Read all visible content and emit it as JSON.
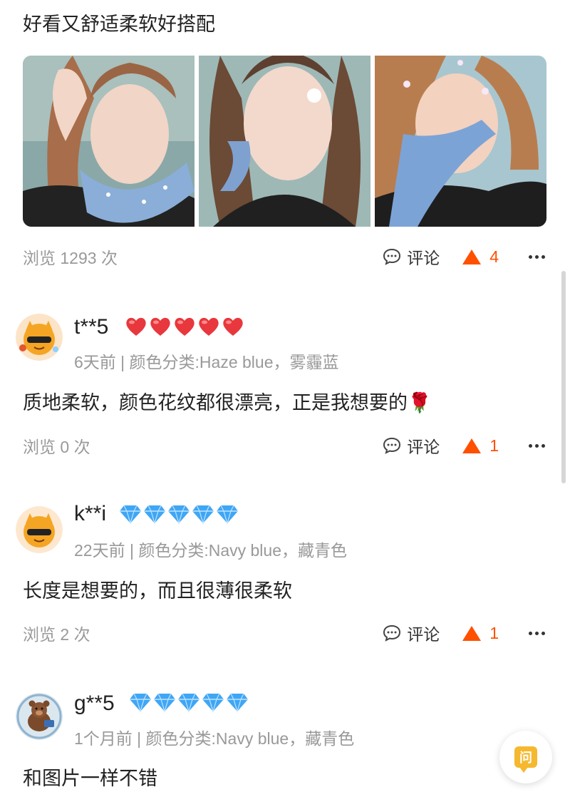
{
  "post": {
    "text": "好看又舒适柔软好搭配",
    "views": "浏览 1293 次",
    "comment_label": "评论",
    "likes": "4"
  },
  "reviews": [
    {
      "username": "t**5",
      "badge_type": "heart",
      "badge_count": 5,
      "meta": "6天前 | 颜色分类:Haze blue，雾霾蓝",
      "content": "质地柔软，颜色花纹都很漂亮，正是我想要的🌹",
      "views": "浏览 0 次",
      "comment_label": "评论",
      "likes": "1"
    },
    {
      "username": "k**i",
      "badge_type": "diamond",
      "badge_count": 5,
      "meta": "22天前 | 颜色分类:Navy blue，藏青色",
      "content": "长度是想要的，而且很薄很柔软",
      "views": "浏览 2 次",
      "comment_label": "评论",
      "likes": "1"
    },
    {
      "username": "g**5",
      "badge_type": "diamond",
      "badge_count": 5,
      "meta": "1个月前 | 颜色分类:Navy blue，藏青色",
      "content": "和图片一样不错"
    }
  ],
  "ask_button": {
    "label": "问"
  },
  "colors": {
    "accent": "#ff5000",
    "muted": "#999999",
    "heart": "#e8373d",
    "diamond": "#3fa6f5"
  }
}
